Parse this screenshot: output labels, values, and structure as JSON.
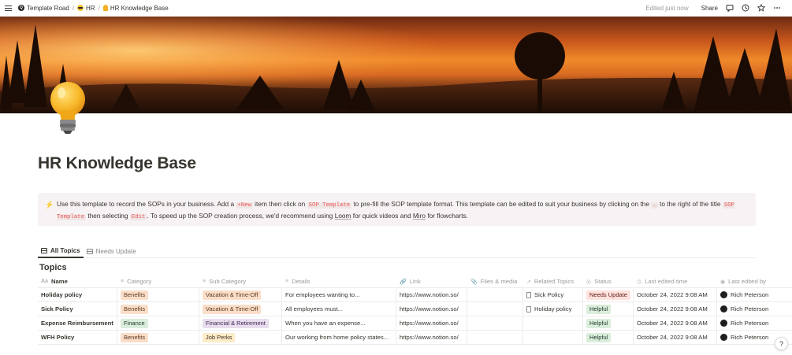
{
  "breadcrumbs": [
    {
      "label": "Template Road",
      "icon": "template-road-logo"
    },
    {
      "label": "HR",
      "icon": "grin-emoji"
    },
    {
      "label": "HR Knowledge Base",
      "icon": "lightbulb-emoji"
    }
  ],
  "topbar": {
    "edited": "Edited just now",
    "share": "Share"
  },
  "page": {
    "title": "HR Knowledge Base",
    "page_icon": "lightbulb"
  },
  "callout": {
    "icon": "⚡",
    "t1": "Use this template to record the SOPs in your business. Add a ",
    "new_code": "+New",
    "t2": " item then click on ",
    "sop_code1": "SOP Template",
    "t3": " to pre-fill the SOP template format. This template can be edited to suit your business by clicking on the ",
    "dots_code": "…",
    "t4": " to the right of the title ",
    "sop_code2": "SOP Template",
    "t5": " then selecting ",
    "edit_code": "Edit",
    "t6": ". To speed up the SOP creation process, we'd recommend using ",
    "loom": "Loom",
    "t7": " for quick videos and ",
    "miro": "Miro",
    "t8": " for flowcharts."
  },
  "views": [
    {
      "label": "All Topics",
      "active": true
    },
    {
      "label": "Needs Update",
      "active": false
    }
  ],
  "database": {
    "title": "Topics",
    "columns": [
      {
        "label": "Name",
        "icon": "Aa"
      },
      {
        "label": "Category",
        "icon": "≡"
      },
      {
        "label": "Sub Category",
        "icon": "≡"
      },
      {
        "label": "Details",
        "icon": "≡"
      },
      {
        "label": "Link",
        "icon": "🔗"
      },
      {
        "label": "Files & media",
        "icon": "📎"
      },
      {
        "label": "Related Topics",
        "icon": "↗"
      },
      {
        "label": "Status",
        "icon": "◎"
      },
      {
        "label": "Last edited time",
        "icon": "◷"
      },
      {
        "label": "Last edited by",
        "icon": "◉"
      }
    ],
    "rows": [
      {
        "name": "Holiday policy",
        "category": "Benefits",
        "sub": "Vacation & Time-Off",
        "details": "For employees wanting to...",
        "link": "https://www.notion.so/",
        "files": "",
        "related": "Sick Policy",
        "status": "Needs Update",
        "time": "October 24, 2022 9:08 AM",
        "by": "Rich Peterson"
      },
      {
        "name": "Sick Policy",
        "category": "Benefits",
        "sub": "Vacation & Time-Off",
        "details": "All employees must...",
        "link": "https://www.notion.so/",
        "files": "",
        "related": "Holiday policy",
        "status": "Helpful",
        "time": "October 24, 2022 9:08 AM",
        "by": "Rich Peterson"
      },
      {
        "name": "Expense Reimbursement",
        "category": "Finance",
        "sub": "Financial & Retirement",
        "details": "When you have an expense...",
        "link": "https://www.notion.so/",
        "files": "",
        "related": "",
        "status": "Helpful",
        "time": "October 24, 2022 9:08 AM",
        "by": "Rich Peterson"
      },
      {
        "name": "WFH Policy",
        "category": "Benefits",
        "sub": "Job Perks",
        "details": "Our working from home policy states...",
        "link": "https://www.notion.so/",
        "files": "",
        "related": "",
        "status": "Helpful",
        "time": "October 24, 2022 9:08 AM",
        "by": "Rich Peterson"
      }
    ]
  },
  "help": "?"
}
